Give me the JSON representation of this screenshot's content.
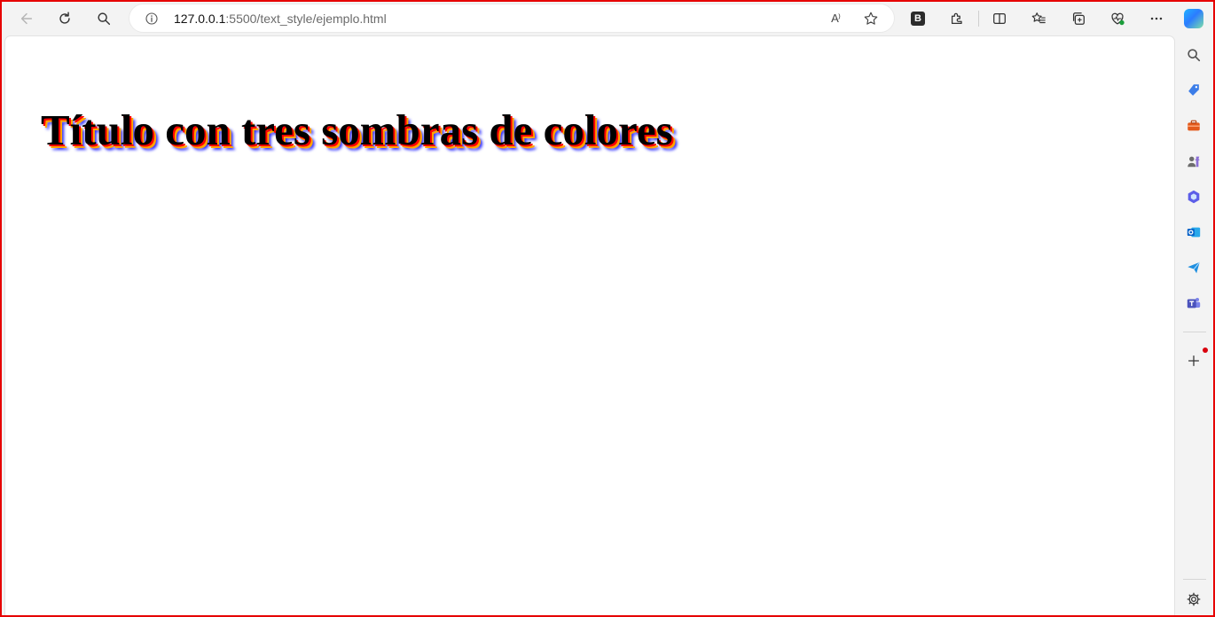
{
  "browser": {
    "url_host": "127.0.0.1",
    "url_path": ":5500/text_style/ejemplo.html",
    "read_aloud_glyph": "A⁾",
    "extension_letter": "B"
  },
  "page": {
    "title": "Título con tres sombras de colores",
    "title_shadow_colors": [
      "#ff0000",
      "#ffa500",
      "#2a2aff"
    ]
  },
  "icons": {
    "toolbar": [
      "back-arrow-icon",
      "refresh-icon",
      "search-icon",
      "info-icon",
      "read-aloud-icon",
      "favorite-star-icon",
      "bootstrap-extension-icon",
      "extensions-puzzle-icon",
      "split-screen-icon",
      "favorites-icon",
      "collections-icon",
      "browser-essentials-icon",
      "more-menu-icon",
      "copilot-icon"
    ],
    "sidebar": [
      "search-icon",
      "shopping-tag-icon",
      "tools-icon",
      "games-icon",
      "microsoft-365-icon",
      "outlook-icon",
      "drop-icon",
      "teams-icon",
      "add-icon",
      "settings-gear-icon"
    ]
  },
  "colors": {
    "frame": "#e60000",
    "chrome_background": "#f3f3f3"
  }
}
